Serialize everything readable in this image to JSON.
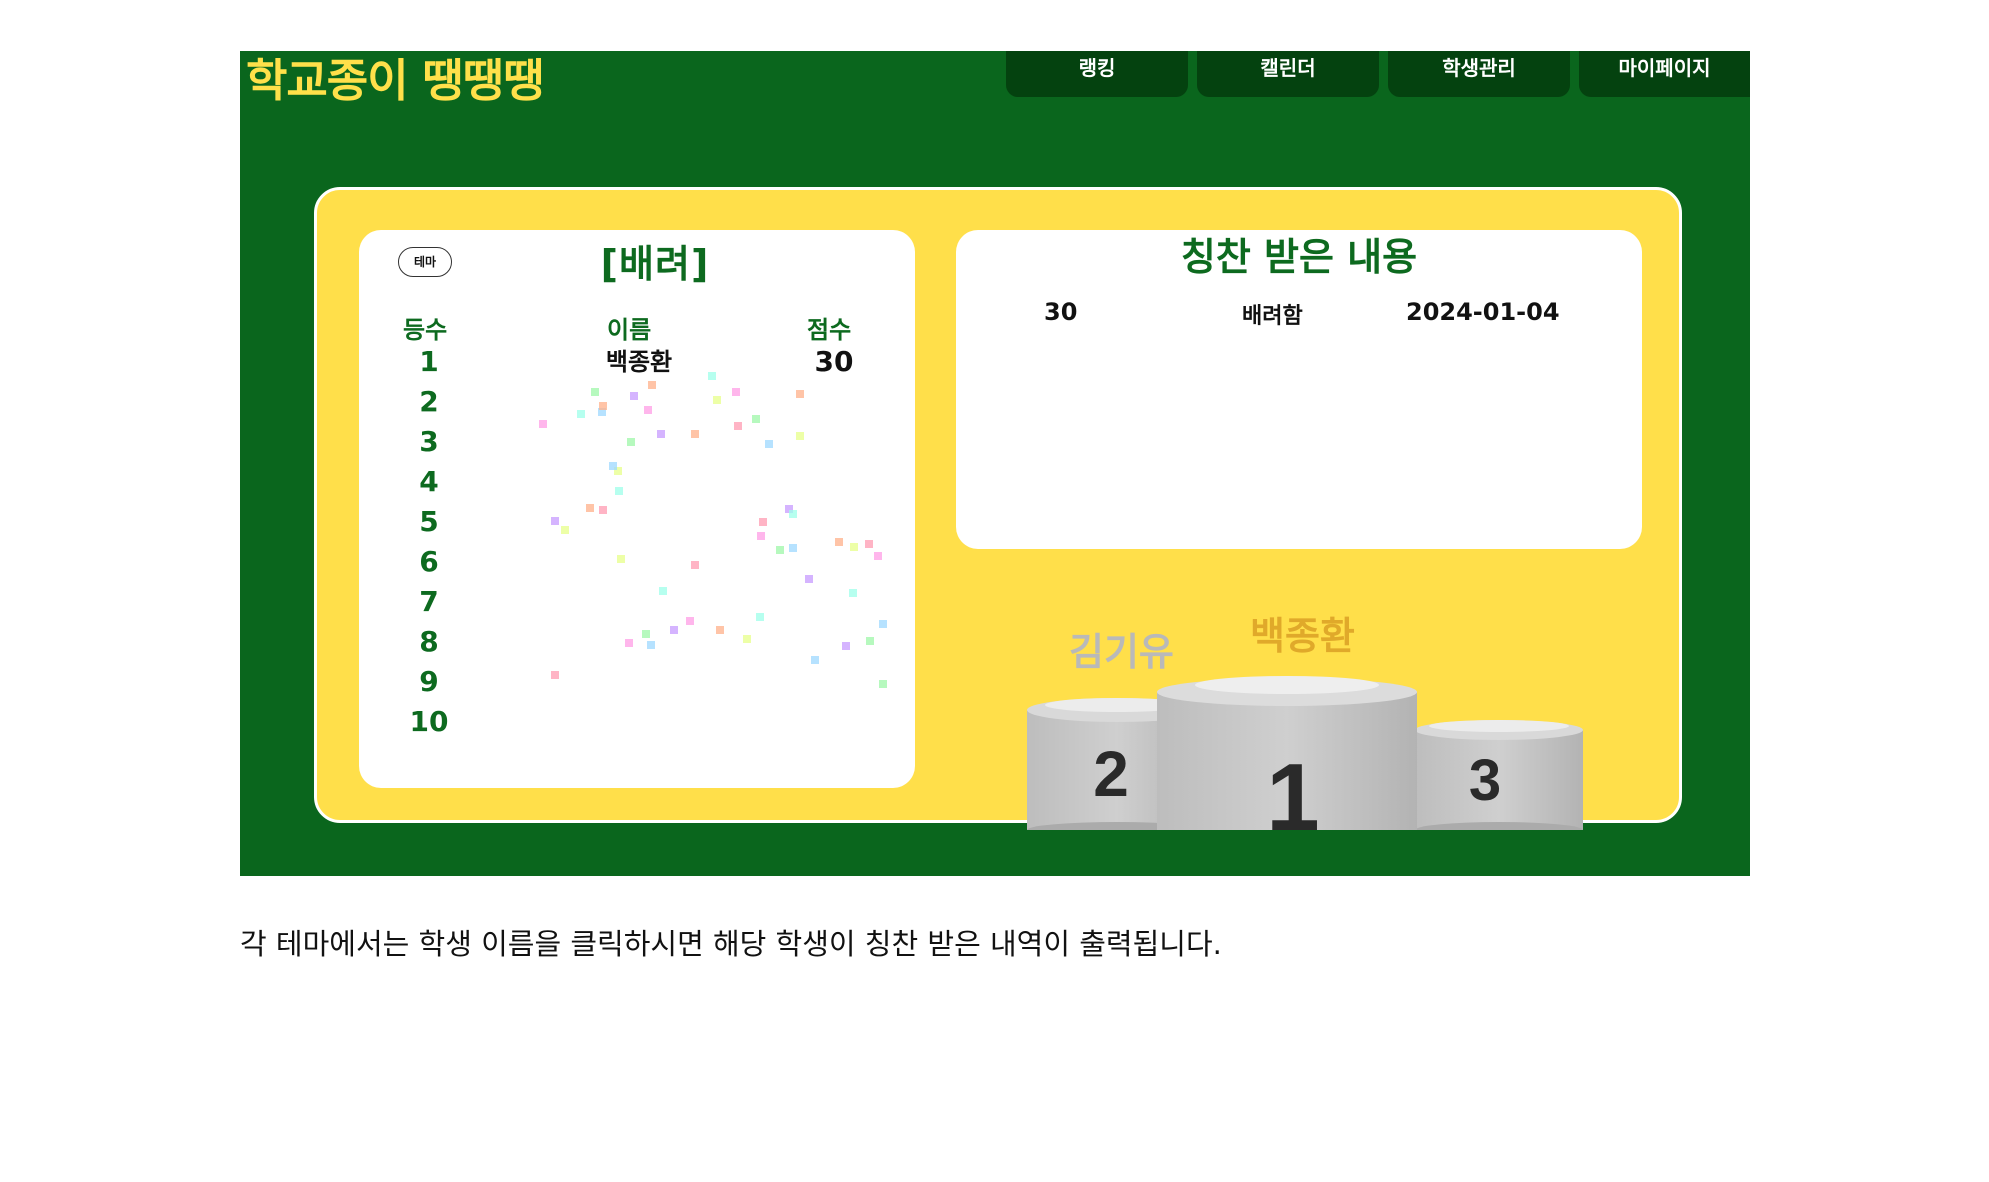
{
  "app": {
    "title": "학교종이 땡땡땡"
  },
  "nav": [
    {
      "label": "랭킹"
    },
    {
      "label": "캘린더"
    },
    {
      "label": "학생관리"
    },
    {
      "label": "마이페이지"
    }
  ],
  "ranking": {
    "theme_button": "테마",
    "theme_title": "[배려]",
    "headers": {
      "rank": "등수",
      "name": "이름",
      "score": "점수"
    },
    "ranks": [
      "1",
      "2",
      "3",
      "4",
      "5",
      "6",
      "7",
      "8",
      "9",
      "10"
    ],
    "rows": [
      {
        "name": "백종환",
        "score": "30"
      }
    ]
  },
  "praise": {
    "title": "칭찬 받은 내용",
    "rows": [
      {
        "score": "30",
        "content": "배려함",
        "date": "2024-01-04"
      }
    ]
  },
  "podium": {
    "first": "백종환",
    "second": "김기유",
    "place_labels": [
      "1",
      "2",
      "3"
    ]
  },
  "caption": "각 테마에서는 학생 이름을 클릭하시면 해당 학생이 칭찬 받은 내역이 출력됩니다.",
  "colors": {
    "header_green": "#0a661d",
    "nav_dark": "#04420f",
    "yellow": "#ffdf4a",
    "title_green": "#0d6a1f",
    "gold": "#e0a92a",
    "silver": "#b9b9b9"
  }
}
